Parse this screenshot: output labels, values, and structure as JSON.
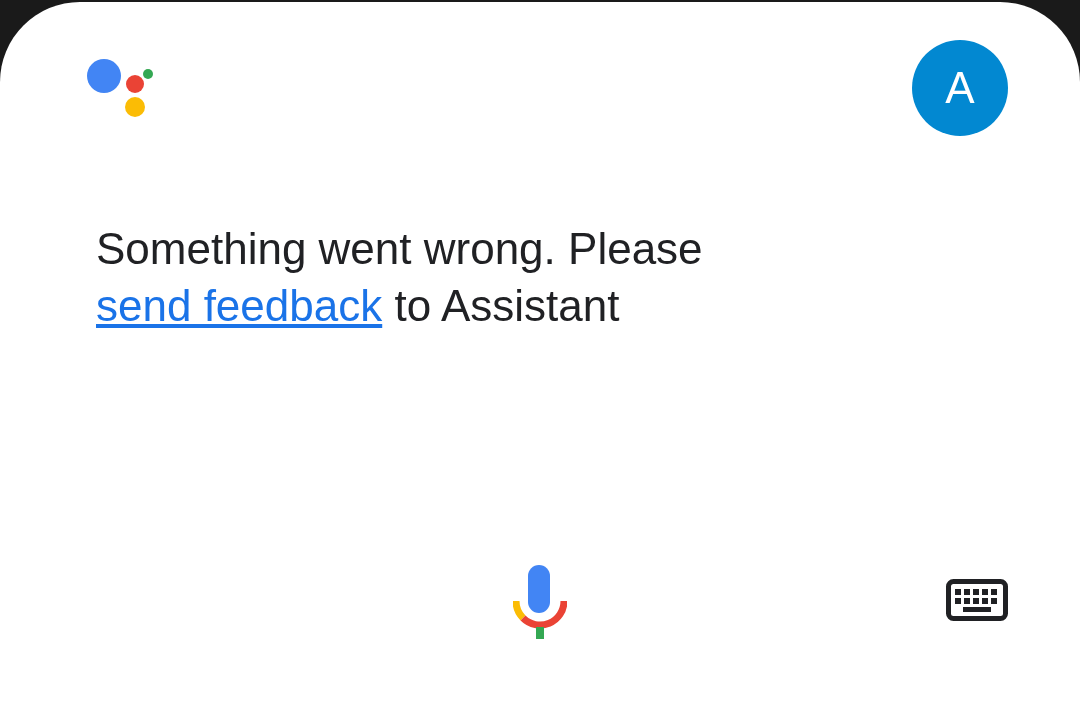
{
  "avatar": {
    "initial": "A"
  },
  "message": {
    "before": "Something went wrong. Please",
    "link": "send feedback",
    "after": "to Assistant"
  }
}
